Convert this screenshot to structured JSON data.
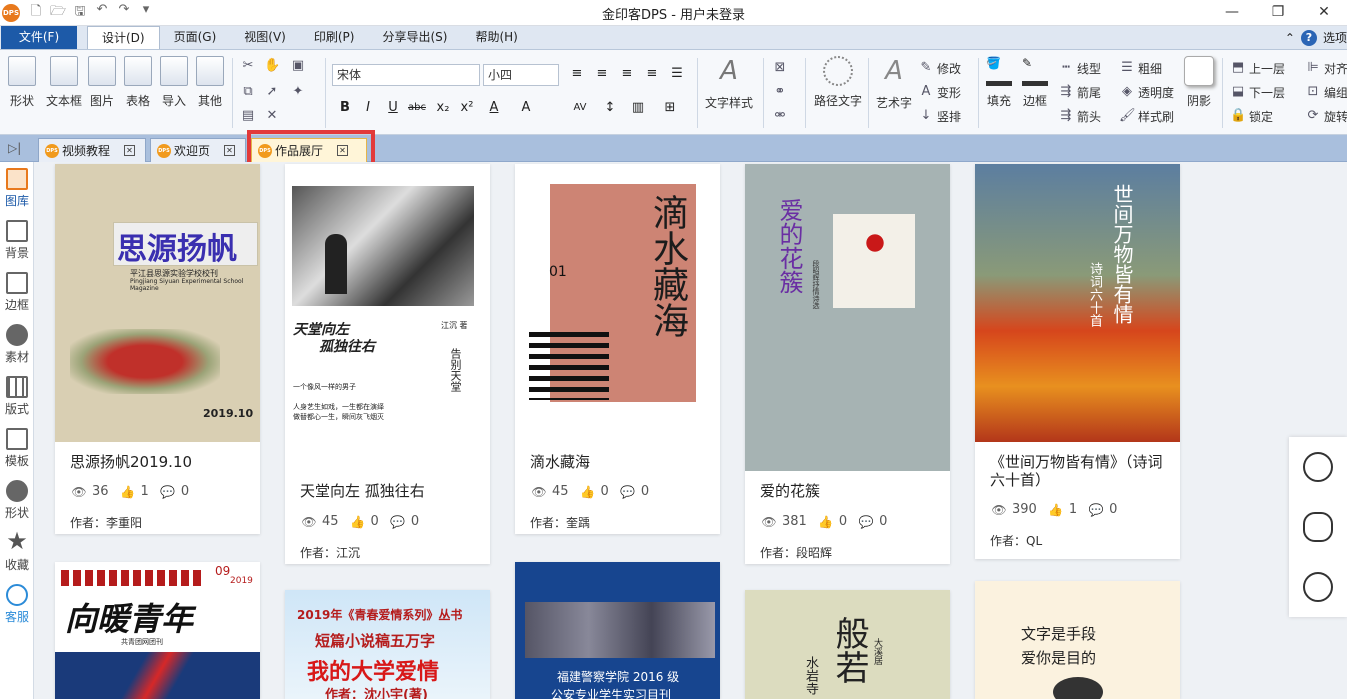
{
  "window": {
    "title": "金印客DPS - 用户未登录",
    "logo_text": "DPS"
  },
  "menu": {
    "file": "文件(F)",
    "items": [
      "设计(D)",
      "页面(G)",
      "视图(V)",
      "印刷(P)",
      "分享导出(S)",
      "帮助(H)"
    ],
    "options": "选项"
  },
  "ribbon": {
    "insert": [
      "形状",
      "文本框",
      "图片",
      "表格",
      "导入",
      "其他"
    ],
    "font": "宋体",
    "size": "小四",
    "art_style": "文字样式",
    "path_text": "路径文字",
    "art_text": "艺术字",
    "modify": "修改",
    "transform": "变形",
    "vertical": "竖排",
    "fill": "填充",
    "border": "边框",
    "line_type": "线型",
    "thickness": "粗细",
    "arrow_tail": "箭尾",
    "transparency": "透明度",
    "arrow_head": "箭头",
    "style_brush": "样式刷",
    "shadow": "阴影",
    "up_layer": "上一层",
    "down_layer": "下一层",
    "lock": "锁定",
    "align": "对齐",
    "group": "编组",
    "rotate": "旋转"
  },
  "tabs": [
    {
      "label": "视频教程"
    },
    {
      "label": "欢迎页"
    },
    {
      "label": "作品展厅"
    }
  ],
  "sidebar": [
    "图库",
    "背景",
    "边框",
    "素材",
    "版式",
    "模板",
    "形状",
    "收藏",
    "客服"
  ],
  "cards": [
    {
      "title": "思源扬帆2019.10",
      "views": "36",
      "likes": "1",
      "comments": "0",
      "author": "作者：李重阳",
      "cover_title": "思源扬帆",
      "cover_sub": "平江县思源实验学校校刊",
      "cover_sub2": "Pingjiang Siyuan Experimental School Magazine",
      "cover_date": "2019.10"
    },
    {
      "title": "天堂向左 孤独往右",
      "views": "45",
      "likes": "0",
      "comments": "0",
      "author": "作者：江沉",
      "cover_title1": "天堂向左",
      "cover_title2": "孤独往右",
      "cover_author": "江沉 著",
      "cover_side": "告别天堂",
      "cover_line1": "一个像风一样的男子",
      "cover_line2": "人身艺生如戏，一生都在演绎",
      "cover_line3": "做替都心一生，瞬间灰飞烟灭"
    },
    {
      "title": "滴水藏海",
      "views": "45",
      "likes": "0",
      "comments": "0",
      "author": "作者：奎踽",
      "cover_title": "滴水藏海",
      "cover_num": "01"
    },
    {
      "title": "爱的花簇",
      "views": "381",
      "likes": "0",
      "comments": "0",
      "author": "作者：段昭辉",
      "cover_title": "爱的花簇",
      "cover_sub": "段昭辉抒情诗选"
    },
    {
      "title": "《世间万物皆有情》（诗词六十首）",
      "views": "390",
      "likes": "1",
      "comments": "0",
      "author": "作者：QL",
      "cover_title": "世间万物皆有情",
      "cover_sub": "诗词六十首"
    },
    {
      "cover_year": "2019",
      "cover_month": "09",
      "cover_title": "向暖青年",
      "cover_sub": "共青团网团刊"
    },
    {
      "cover_line1": "2019年《青春爱情系列》丛书",
      "cover_line2": "短篇小说稿五万字",
      "cover_line3": "我的大学爱情",
      "cover_line4": "作者：沈小宇(著)"
    },
    {
      "cover_line1": "福建警察学院 2016 级",
      "cover_line2": "公安专业学生实习目刊"
    },
    {
      "cover_title": "般若",
      "cover_side1": "水岩寺",
      "cover_side2": "大溪居"
    },
    {
      "cover_line1": "文字是手段",
      "cover_line2": "爱你是目的"
    }
  ]
}
